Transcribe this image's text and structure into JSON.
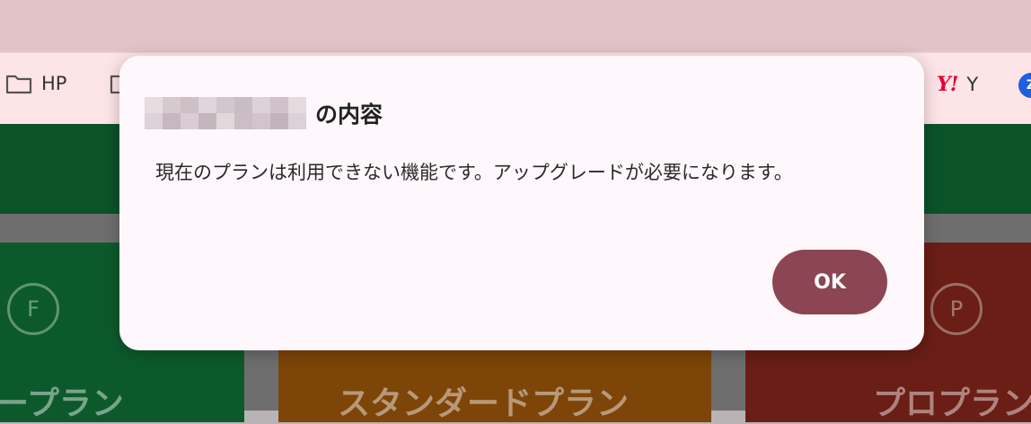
{
  "bookmarks": {
    "items": [
      {
        "label": "HP",
        "icon": "folder-icon"
      },
      {
        "label": "",
        "icon": "folder-icon"
      },
      {
        "label": "Y",
        "icon": "yahoo-icon",
        "icon_text": "Y!"
      },
      {
        "label": "",
        "icon": "z-icon",
        "icon_text": "Z"
      }
    ]
  },
  "background_page": {
    "plans": [
      {
        "title": "ープラン",
        "badge": "F"
      },
      {
        "title": "スタンダードプラン"
      },
      {
        "title": "プロプラン",
        "badge": "P"
      }
    ]
  },
  "dialog": {
    "title_suffix": "の内容",
    "message": "現在のプランは利用できない機能です。アップグレードが必要になります。",
    "ok_label": "OK"
  },
  "colors": {
    "dialog_bg": "#fef7fb",
    "ok_button": "#8c4552",
    "bookmark_bar": "#fde4e7",
    "tab_bar": "#e2c3c8"
  }
}
